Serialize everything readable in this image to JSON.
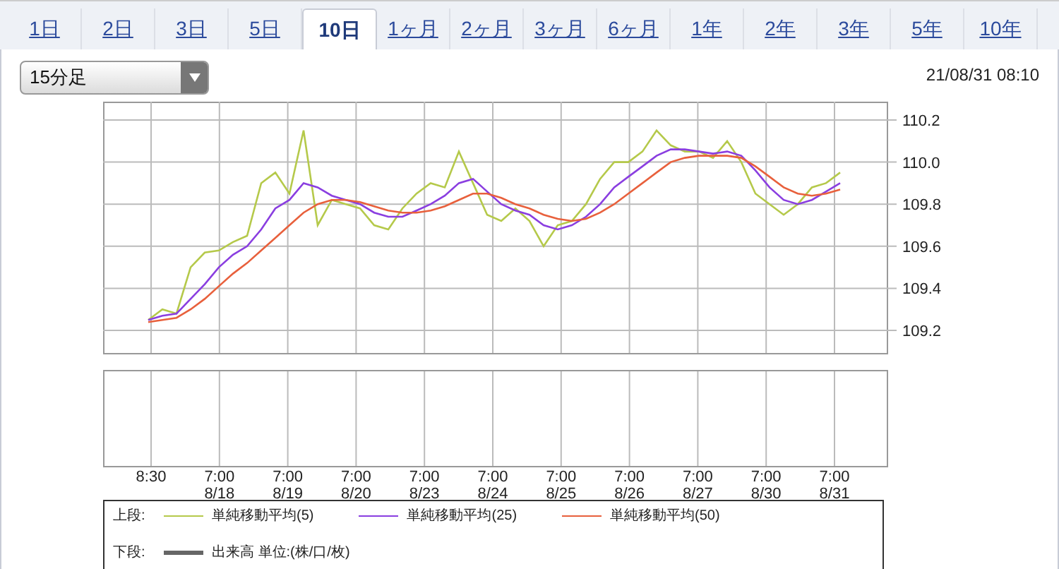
{
  "tabs": [
    {
      "label": "1日",
      "selected": false
    },
    {
      "label": "2日",
      "selected": false
    },
    {
      "label": "3日",
      "selected": false
    },
    {
      "label": "5日",
      "selected": false
    },
    {
      "label": "10日",
      "selected": true
    },
    {
      "label": "1ヶ月",
      "selected": false
    },
    {
      "label": "2ヶ月",
      "selected": false
    },
    {
      "label": "3ヶ月",
      "selected": false
    },
    {
      "label": "6ヶ月",
      "selected": false
    },
    {
      "label": "1年",
      "selected": false
    },
    {
      "label": "2年",
      "selected": false
    },
    {
      "label": "3年",
      "selected": false
    },
    {
      "label": "5年",
      "selected": false
    },
    {
      "label": "10年",
      "selected": false
    }
  ],
  "interval_select": {
    "value": "15分足"
  },
  "timestamp": "21/08/31 08:10",
  "chart": {
    "chart_data": {
      "type": "line",
      "categories": [
        null,
        null,
        null,
        null,
        null,
        null,
        null,
        null,
        null,
        null,
        null,
        null,
        null,
        null,
        null,
        null,
        null,
        null,
        null,
        null,
        null,
        null,
        null,
        null,
        null,
        null,
        null,
        null,
        null,
        null,
        null,
        null,
        null,
        null,
        null,
        null,
        null,
        null,
        null,
        null,
        null,
        null,
        null,
        null,
        null,
        null,
        null,
        null,
        null,
        null
      ],
      "ylim": [
        109.093,
        110.287
      ],
      "grid": true,
      "yticks": [
        {
          "value": 109.2,
          "label": "109.2"
        },
        {
          "value": 109.4,
          "label": "109.4"
        },
        {
          "value": 109.6,
          "label": "109.6"
        },
        {
          "value": 109.8,
          "label": "109.8"
        },
        {
          "value": 110.0,
          "label": "110.0"
        },
        {
          "value": 110.2,
          "label": "110.2"
        }
      ],
      "series": [
        {
          "name": "単純移動平均(5)",
          "color": "#b5c94a",
          "values": [
            109.25,
            109.3,
            109.28,
            109.5,
            109.57,
            109.58,
            109.62,
            109.65,
            109.9,
            109.95,
            109.85,
            110.15,
            109.7,
            109.82,
            109.8,
            109.78,
            109.7,
            109.68,
            109.78,
            109.85,
            109.9,
            109.88,
            110.05,
            109.9,
            109.75,
            109.72,
            109.78,
            109.72,
            109.6,
            109.7,
            109.72,
            109.8,
            109.92,
            110.0,
            110.0,
            110.05,
            110.15,
            110.08,
            110.05,
            110.05,
            110.02,
            110.1,
            110.0,
            109.85,
            109.8,
            109.75,
            109.8,
            109.88,
            109.9,
            109.95
          ]
        },
        {
          "name": "単純移動平均(25)",
          "color": "#8a3ee0",
          "values": [
            109.25,
            109.27,
            109.28,
            109.35,
            109.42,
            109.5,
            109.56,
            109.6,
            109.68,
            109.78,
            109.82,
            109.9,
            109.88,
            109.84,
            109.82,
            109.8,
            109.76,
            109.74,
            109.74,
            109.77,
            109.8,
            109.84,
            109.9,
            109.92,
            109.86,
            109.8,
            109.77,
            109.75,
            109.7,
            109.68,
            109.7,
            109.74,
            109.8,
            109.88,
            109.93,
            109.98,
            110.03,
            110.06,
            110.06,
            110.05,
            110.04,
            110.05,
            110.03,
            109.96,
            109.88,
            109.82,
            109.8,
            109.82,
            109.86,
            109.9
          ]
        },
        {
          "name": "単純移動平均(50)",
          "color": "#e8603c",
          "values": [
            109.24,
            109.25,
            109.26,
            109.3,
            109.35,
            109.41,
            109.47,
            109.52,
            109.58,
            109.64,
            109.7,
            109.76,
            109.8,
            109.82,
            109.82,
            109.81,
            109.79,
            109.77,
            109.76,
            109.76,
            109.77,
            109.79,
            109.82,
            109.85,
            109.85,
            109.83,
            109.8,
            109.78,
            109.75,
            109.73,
            109.72,
            109.73,
            109.76,
            109.8,
            109.85,
            109.9,
            109.95,
            110.0,
            110.02,
            110.03,
            110.03,
            110.03,
            110.02,
            109.98,
            109.93,
            109.88,
            109.85,
            109.84,
            109.85,
            109.87
          ]
        }
      ]
    },
    "time_axis": [
      {
        "time": "8:30"
      },
      {
        "time": "7:00",
        "date": "8/18"
      },
      {
        "time": "7:00",
        "date": "8/19"
      },
      {
        "time": "7:00",
        "date": "8/20"
      },
      {
        "time": "7:00",
        "date": "8/23"
      },
      {
        "time": "7:00",
        "date": "8/24"
      },
      {
        "time": "7:00",
        "date": "8/25"
      },
      {
        "time": "7:00",
        "date": "8/26"
      },
      {
        "time": "7:00",
        "date": "8/27"
      },
      {
        "time": "7:00",
        "date": "8/30"
      },
      {
        "time": "7:00",
        "date": "8/31"
      }
    ]
  },
  "legend": {
    "upper": {
      "label": "上段:"
    },
    "lower": {
      "label": "下段:",
      "items": [
        {
          "name": "出来高 単位:(株/口/枚)",
          "color": "#666666"
        }
      ]
    }
  }
}
